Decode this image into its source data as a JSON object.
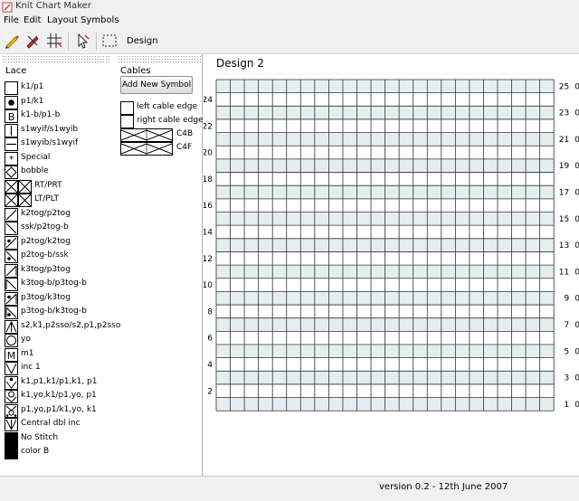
{
  "window": {
    "title": "Knit Chart Maker"
  },
  "menubar": {
    "items": [
      "File",
      "Edit",
      "Layout",
      "Symbols"
    ]
  },
  "toolbar": {
    "design_label": "Design"
  },
  "symbols_panel": {
    "lace_label": "Lace",
    "cables_label": "Cables",
    "add_symbol_label": "Add New Symbol",
    "lace_items": [
      {
        "label": "k1/p1",
        "icon": "empty-square-icon"
      },
      {
        "label": "p1/k1",
        "icon": "dot-icon"
      },
      {
        "label": "k1-b/p1-b",
        "icon": "letter-b-icon"
      },
      {
        "label": "s1wyif/s1wyib",
        "icon": "vertical-bar-icon"
      },
      {
        "label": "s1wyib/s1wyif",
        "icon": "horizontal-bar-icon"
      },
      {
        "label": "Special",
        "icon": "asterisk-icon"
      },
      {
        "label": "bobble",
        "icon": "diamond-icon"
      },
      {
        "label": "RT/PRT",
        "icon": "right-twist-icon"
      },
      {
        "label": "LT/PLT",
        "icon": "left-twist-icon"
      },
      {
        "label": "k2tog/p2tog",
        "icon": "right-slant-icon"
      },
      {
        "label": "ssk/p2tog-b",
        "icon": "left-slant-icon"
      },
      {
        "label": "p2tog/k2tog",
        "icon": "right-slant-dot-icon"
      },
      {
        "label": "p2tog-b/ssk",
        "icon": "left-slant-dot-icon"
      },
      {
        "label": "k3tog/p3tog",
        "icon": "right-slant-bar-icon"
      },
      {
        "label": "k3tog-b/p3tog-b",
        "icon": "left-slant-bar-icon"
      },
      {
        "label": "p3tog/k3tog",
        "icon": "right-slant-bar-dot-icon"
      },
      {
        "label": "p3tog-b/k3tog-b",
        "icon": "left-slant-bar-dot-icon"
      },
      {
        "label": "s2,k1,p2sso/s2,p1,p2sso",
        "icon": "double-decrease-icon"
      },
      {
        "label": "yo",
        "icon": "circle-icon"
      },
      {
        "label": "m1",
        "icon": "letter-m-icon"
      },
      {
        "label": "inc 1",
        "icon": "v-icon"
      },
      {
        "label": "k1,p1,k1/p1,k1, p1",
        "icon": "v-dot-icon"
      },
      {
        "label": "k1,yo,k1/p1,yo, p1",
        "icon": "v-circle-icon"
      },
      {
        "label": "p1,yo,p1/k1,yo, k1",
        "icon": "v-circle-dots-icon"
      },
      {
        "label": "Central dbl inc",
        "icon": "arrow-down-icon"
      },
      {
        "label": "No Stitch",
        "icon": "black-square-icon"
      },
      {
        "label": "color B",
        "icon": "black-square-icon"
      }
    ],
    "cable_items": [
      {
        "label": "left cable edge"
      },
      {
        "label": "right cable edge"
      },
      {
        "label": "C4B"
      },
      {
        "label": "C4F"
      }
    ]
  },
  "chart": {
    "title": "Design 2",
    "columns": 24,
    "rows": 25,
    "left_labels": [
      "2",
      "4",
      "6",
      "8",
      "10",
      "12",
      "14",
      "16",
      "18",
      "20",
      "22",
      "24"
    ],
    "right_labels": [
      "1",
      "3",
      "5",
      "7",
      "9",
      "11",
      "13",
      "15",
      "17",
      "19",
      "21",
      "23",
      "25"
    ],
    "right_marker": "0",
    "odd_row_color": "#e4eef0"
  },
  "statusbar": {
    "version": "version 0.2 - 12th June 2007"
  }
}
